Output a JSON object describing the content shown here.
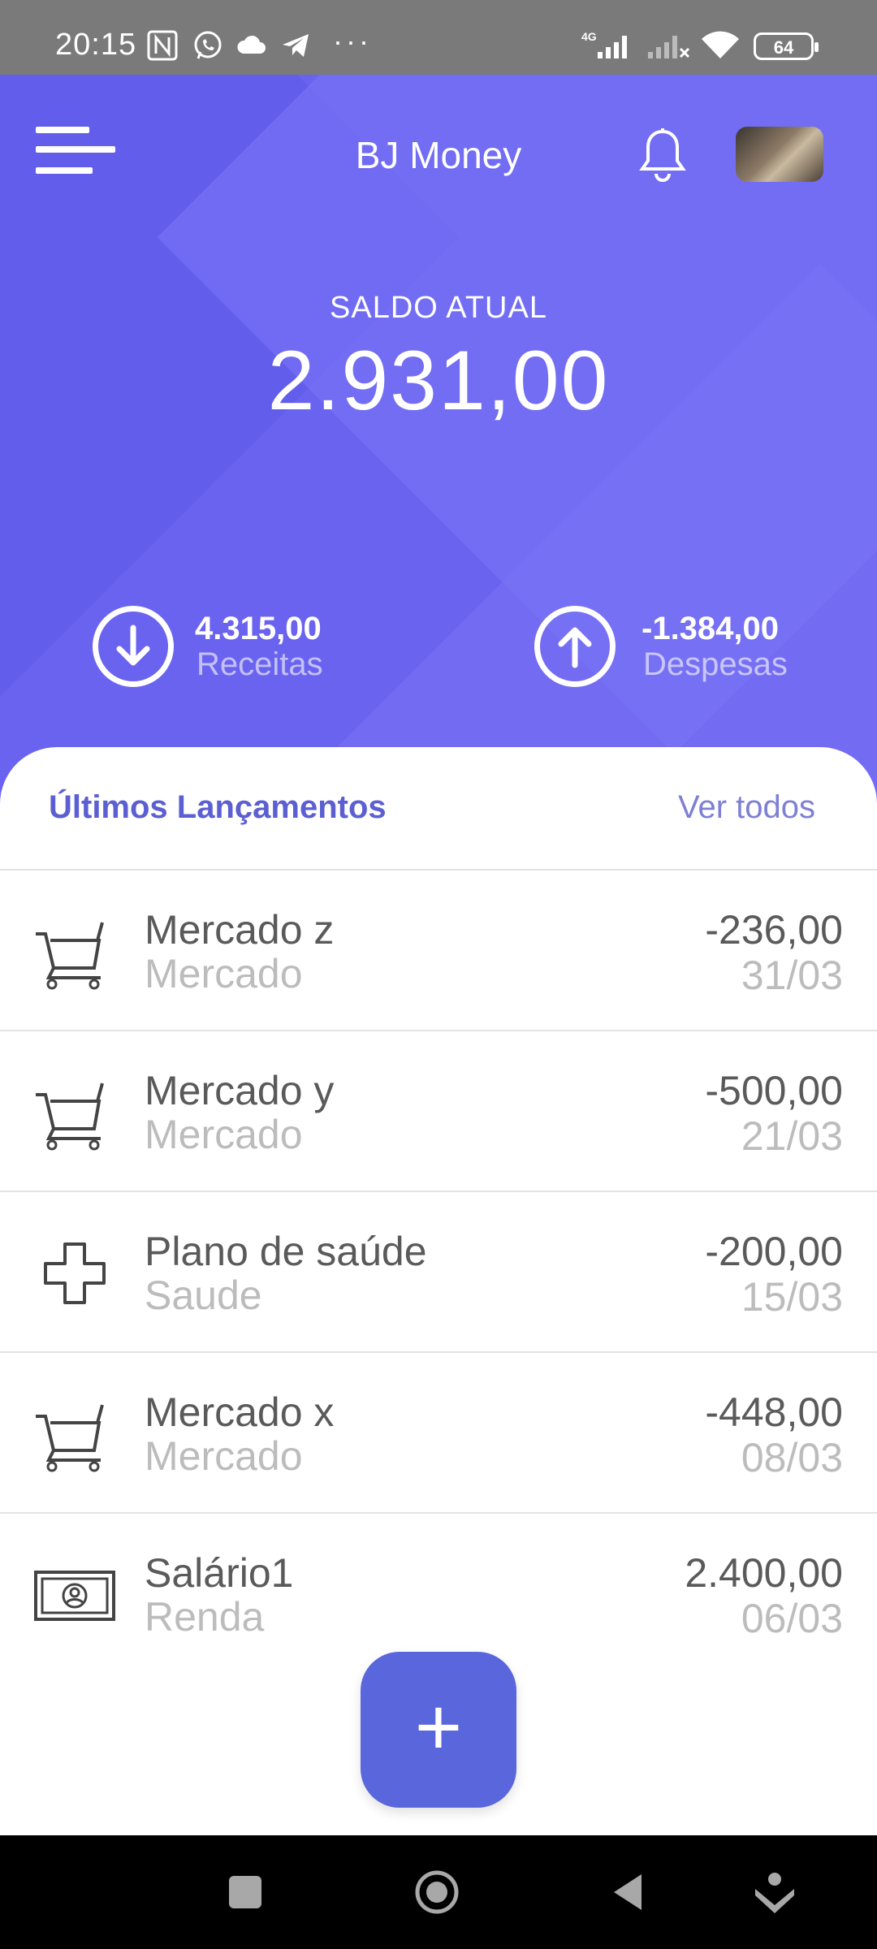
{
  "status_bar": {
    "time": "20:15",
    "battery": "64",
    "network": "4G",
    "icons": [
      "nfc-icon",
      "whatsapp-icon",
      "cloud-icon",
      "telegram-icon",
      "more-dots-icon",
      "signal-icon",
      "signal-no-service-icon",
      "wifi-icon",
      "battery-icon"
    ]
  },
  "header": {
    "title": "BJ Money",
    "menu_icon": "menu-icon",
    "notification_icon": "bell-icon",
    "avatar": "user-avatar"
  },
  "balance": {
    "label": "SALDO ATUAL",
    "value": "2.931,00"
  },
  "summary": {
    "income": {
      "amount": "4.315,00",
      "label": "Receitas",
      "icon": "arrow-down-circle-icon"
    },
    "expense": {
      "amount": "-1.384,00",
      "label": "Despesas",
      "icon": "arrow-up-circle-icon"
    }
  },
  "recent": {
    "title": "Últimos Lançamentos",
    "see_all": "Ver todos",
    "items": [
      {
        "name": "Mercado z",
        "category": "Mercado",
        "value": "-236,00",
        "date": "31/03",
        "icon": "cart-icon"
      },
      {
        "name": "Mercado y",
        "category": "Mercado",
        "value": "-500,00",
        "date": "21/03",
        "icon": "cart-icon"
      },
      {
        "name": "Plano de saúde",
        "category": "Saude",
        "value": "-200,00",
        "date": "15/03",
        "icon": "health-cross-icon"
      },
      {
        "name": "Mercado x",
        "category": "Mercado",
        "value": "-448,00",
        "date": "08/03",
        "icon": "cart-icon"
      },
      {
        "name": "Salário1",
        "category": "Renda",
        "value": "2.400,00",
        "date": "06/03",
        "icon": "banknote-icon"
      }
    ]
  },
  "fab": {
    "label": "+"
  },
  "colors": {
    "hero": "#6a63f0",
    "accent": "#5a66dc",
    "title": "#5b5fd1"
  }
}
